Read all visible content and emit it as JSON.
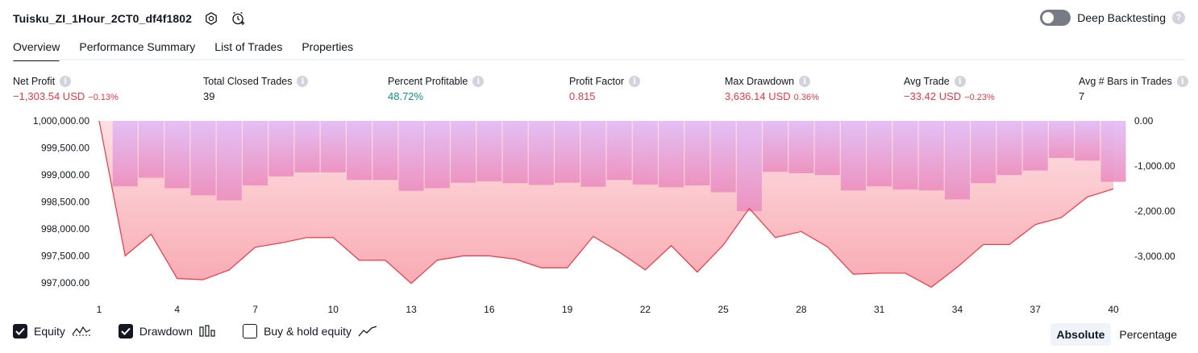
{
  "header": {
    "strategy_name": "Tuisku_ZI_1Hour_2CT0_df4f1802",
    "deep_backtesting_label": "Deep Backtesting"
  },
  "tabs": [
    {
      "label": "Overview",
      "active": true
    },
    {
      "label": "Performance Summary",
      "active": false
    },
    {
      "label": "List of Trades",
      "active": false
    },
    {
      "label": "Properties",
      "active": false
    }
  ],
  "metrics": {
    "net_profit": {
      "label": "Net Profit",
      "value": "−1,303.54 USD",
      "pct": "−0.13%"
    },
    "total_closed_trades": {
      "label": "Total Closed Trades",
      "value": "39"
    },
    "percent_profitable": {
      "label": "Percent Profitable",
      "value": "48.72%"
    },
    "profit_factor": {
      "label": "Profit Factor",
      "value": "0.815"
    },
    "max_drawdown": {
      "label": "Max Drawdown",
      "value": "3,636.14 USD",
      "pct": "0.36%"
    },
    "avg_trade": {
      "label": "Avg Trade",
      "value": "−33.42 USD",
      "pct": "−0.23%"
    },
    "avg_bars": {
      "label": "Avg # Bars in Trades",
      "value": "7"
    }
  },
  "colors": {
    "negative": "#f23645",
    "positive": "#089981",
    "drawdown_bar": "#d6a5f5",
    "equity_line": "#f23645"
  },
  "chart_data": {
    "type": "area",
    "left_axis": {
      "ticks": [
        "1,000,000.00",
        "999,500.00",
        "999,000.00",
        "998,500.00",
        "998,000.00",
        "997,500.00",
        "997,000.00"
      ],
      "tick_values": [
        1000000,
        999500,
        999000,
        998500,
        998000,
        997500,
        997000
      ],
      "range": [
        996750,
        1000000
      ]
    },
    "right_axis": {
      "ticks": [
        "0.00",
        "-1,000.00",
        "-2,000.00",
        "-3,000.00"
      ],
      "tick_values": [
        0,
        -1000,
        -2000,
        -3000
      ],
      "range": [
        -3500,
        0
      ]
    },
    "x_ticks": [
      "1",
      "4",
      "7",
      "10",
      "13",
      "16",
      "19",
      "22",
      "25",
      "28",
      "31",
      "34",
      "37",
      "40"
    ],
    "trade_numbers": [
      1,
      2,
      3,
      4,
      5,
      6,
      7,
      8,
      9,
      10,
      11,
      12,
      13,
      14,
      15,
      16,
      17,
      18,
      19,
      20,
      21,
      22,
      23,
      24,
      25,
      26,
      27,
      28,
      29,
      30,
      31,
      32,
      33,
      34,
      35,
      36,
      37,
      38,
      39,
      40
    ],
    "equity": [
      1000000,
      997500,
      997900,
      997080,
      997060,
      997240,
      997660,
      997740,
      997840,
      997840,
      997420,
      997420,
      996990,
      997420,
      997500,
      997500,
      997440,
      997280,
      997280,
      997860,
      997570,
      997240,
      997690,
      997200,
      997700,
      998380,
      997840,
      997950,
      997670,
      997160,
      997180,
      997180,
      996920,
      997290,
      997710,
      997710,
      998080,
      998210,
      998590,
      998740
    ],
    "drawdown": [
      0,
      -1450,
      -1260,
      -1490,
      -1650,
      -1760,
      -1430,
      -1230,
      -1140,
      -1140,
      -1310,
      -1310,
      -1550,
      -1490,
      -1370,
      -1340,
      -1380,
      -1420,
      -1370,
      -1460,
      -1310,
      -1410,
      -1470,
      -1430,
      -1580,
      -2000,
      -1130,
      -1160,
      -1200,
      -1540,
      -1450,
      -1520,
      -1540,
      -1740,
      -1380,
      -1200,
      -1100,
      -820,
      -880,
      -1350
    ],
    "series": [
      {
        "name": "Equity"
      },
      {
        "name": "Drawdown"
      },
      {
        "name": "Buy & hold equity"
      }
    ]
  },
  "footer": {
    "equity_label": "Equity",
    "drawdown_label": "Drawdown",
    "buyhold_label": "Buy & hold equity",
    "absolute_label": "Absolute",
    "percentage_label": "Percentage"
  }
}
